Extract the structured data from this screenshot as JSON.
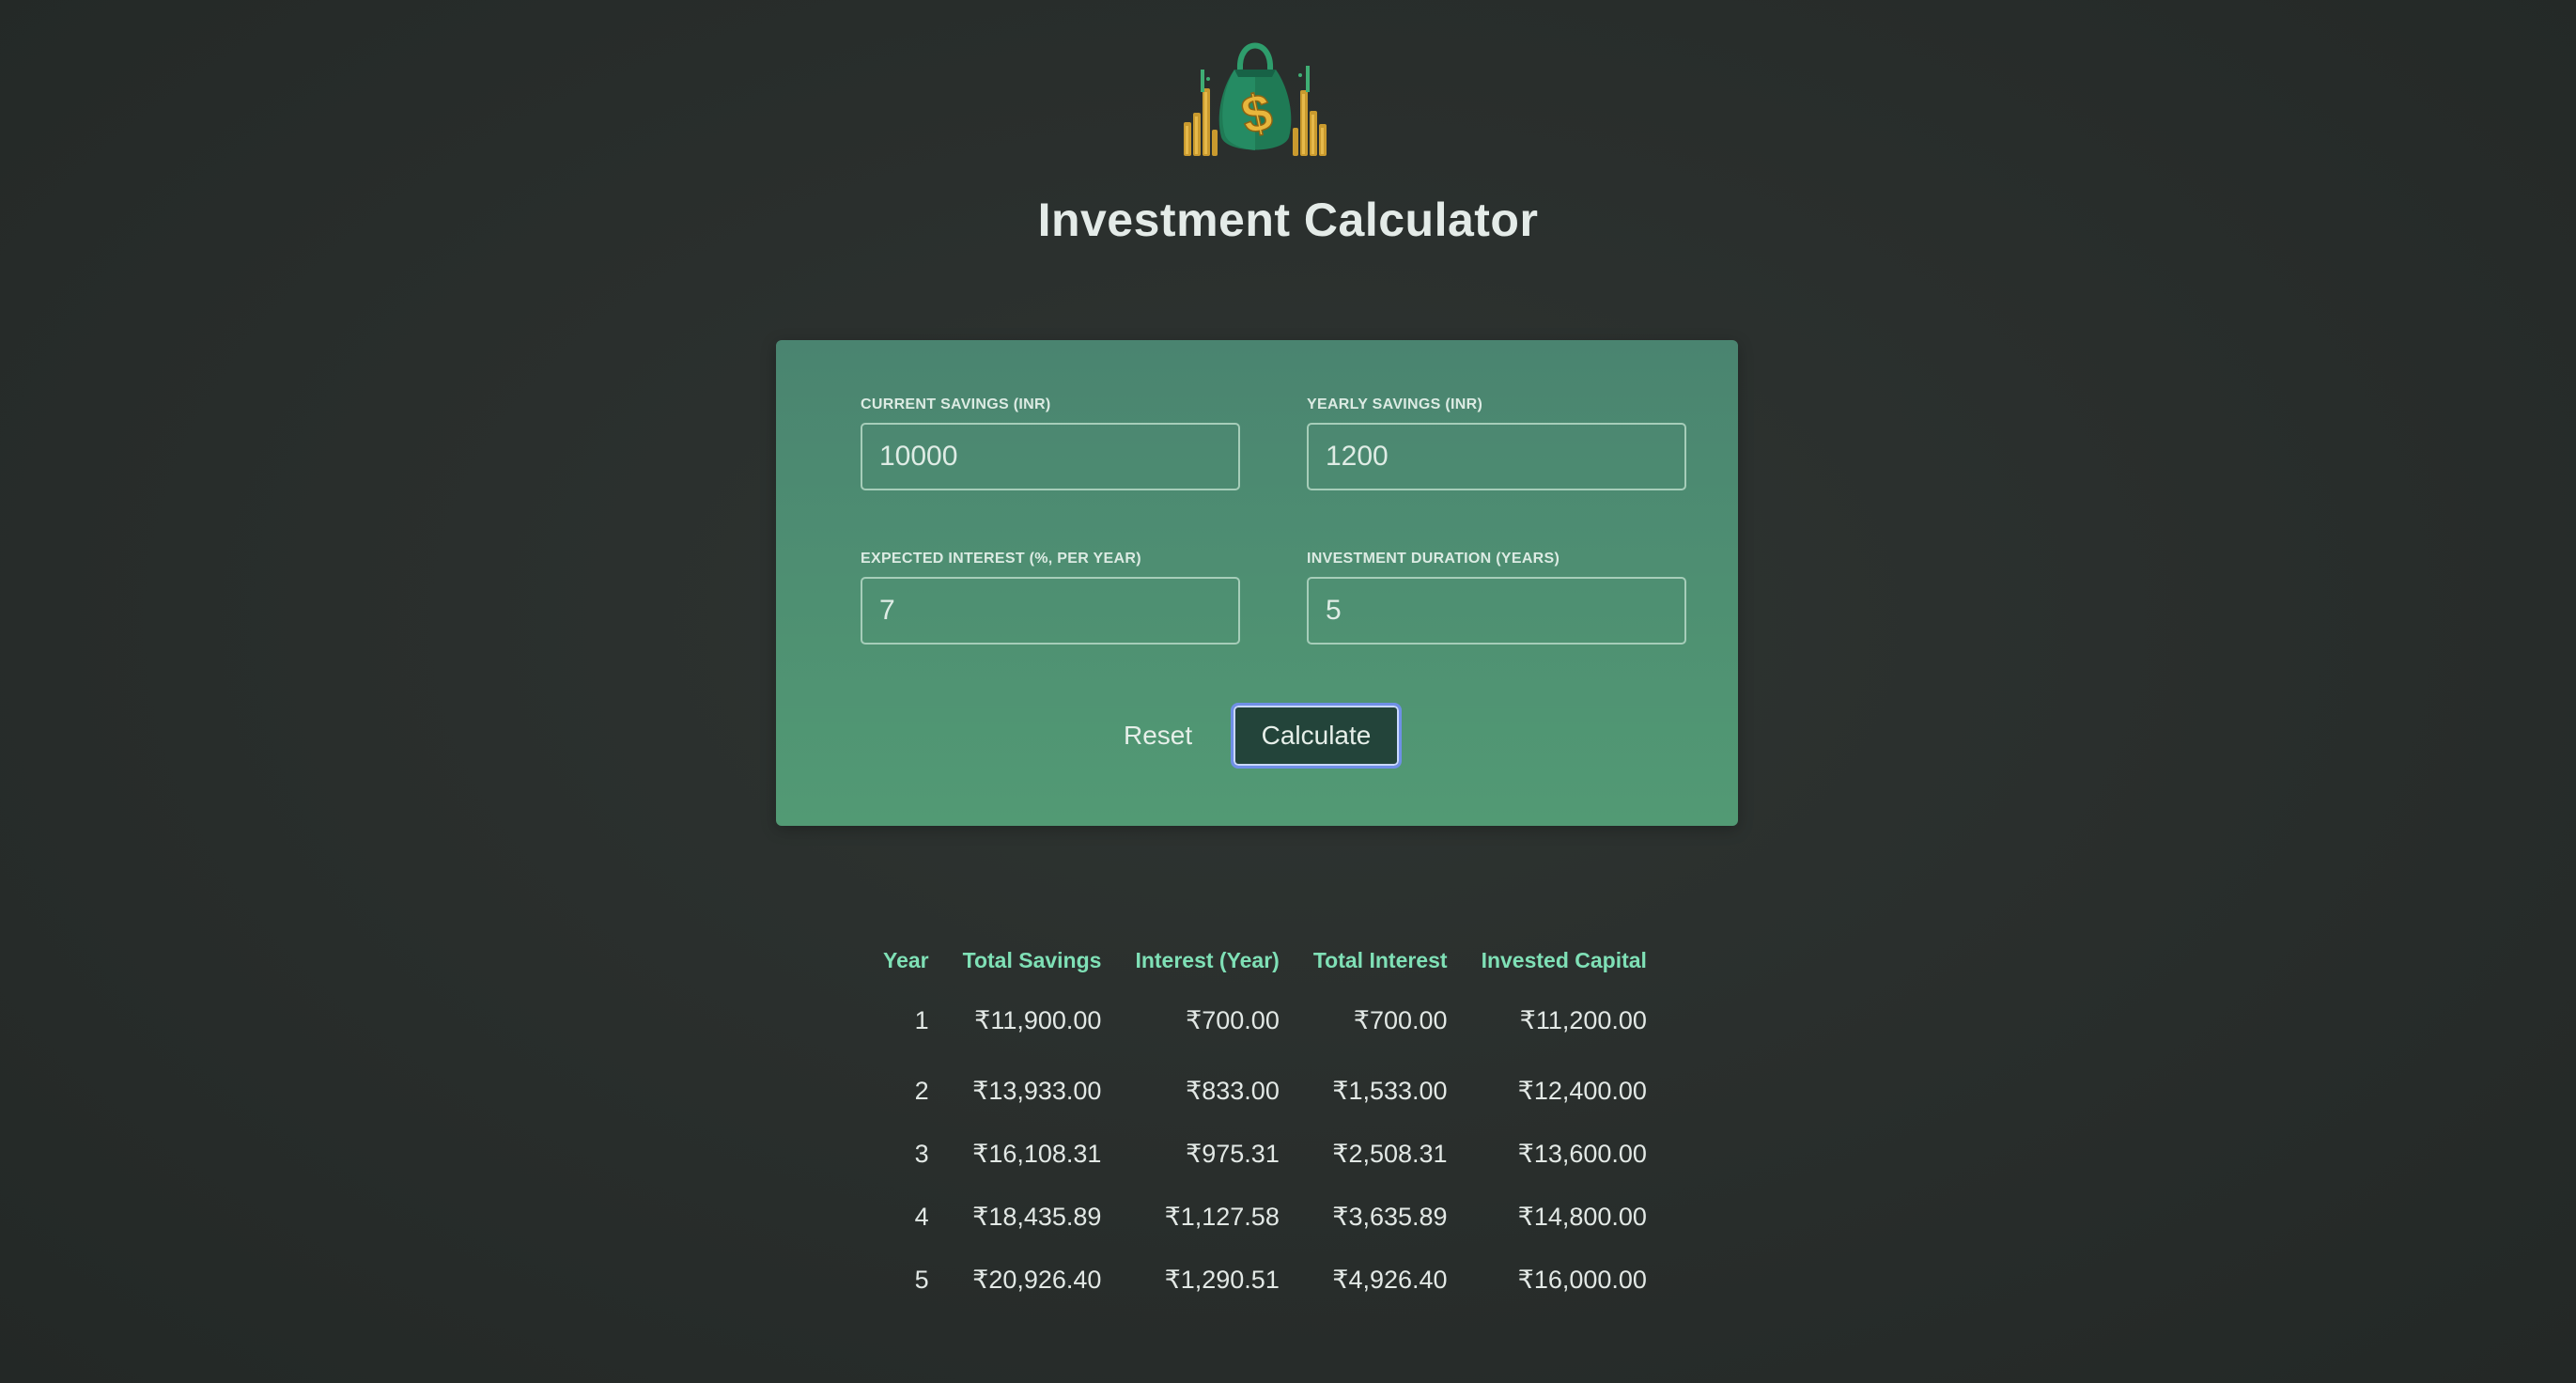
{
  "app": {
    "title": "Investment Calculator"
  },
  "colors": {
    "background": "#2a2f2d",
    "card": "#4f8f74",
    "accent_header": "#7fe0b6",
    "button_dark": "#23443a",
    "focus_ring": "#6f8fe6"
  },
  "logo": {
    "icon": "money-bag-icon",
    "symbol": "$"
  },
  "form": {
    "current_savings": {
      "label": "CURRENT SAVINGS (INR)",
      "value": "10000"
    },
    "yearly_savings": {
      "label": "YEARLY SAVINGS (INR)",
      "value": "1200"
    },
    "expected_interest": {
      "label": "EXPECTED INTEREST (%, PER YEAR)",
      "value": "7"
    },
    "duration": {
      "label": "INVESTMENT DURATION (YEARS)",
      "value": "5"
    },
    "reset_label": "Reset",
    "calculate_label": "Calculate"
  },
  "results": {
    "headers": [
      "Year",
      "Total Savings",
      "Interest (Year)",
      "Total Interest",
      "Invested Capital"
    ],
    "rows": [
      [
        "1",
        "₹11,900.00",
        "₹700.00",
        "₹700.00",
        "₹11,200.00"
      ],
      [
        "2",
        "₹13,933.00",
        "₹833.00",
        "₹1,533.00",
        "₹12,400.00"
      ],
      [
        "3",
        "₹16,108.31",
        "₹975.31",
        "₹2,508.31",
        "₹13,600.00"
      ],
      [
        "4",
        "₹18,435.89",
        "₹1,127.58",
        "₹3,635.89",
        "₹14,800.00"
      ],
      [
        "5",
        "₹20,926.40",
        "₹1,290.51",
        "₹4,926.40",
        "₹16,000.00"
      ]
    ]
  }
}
